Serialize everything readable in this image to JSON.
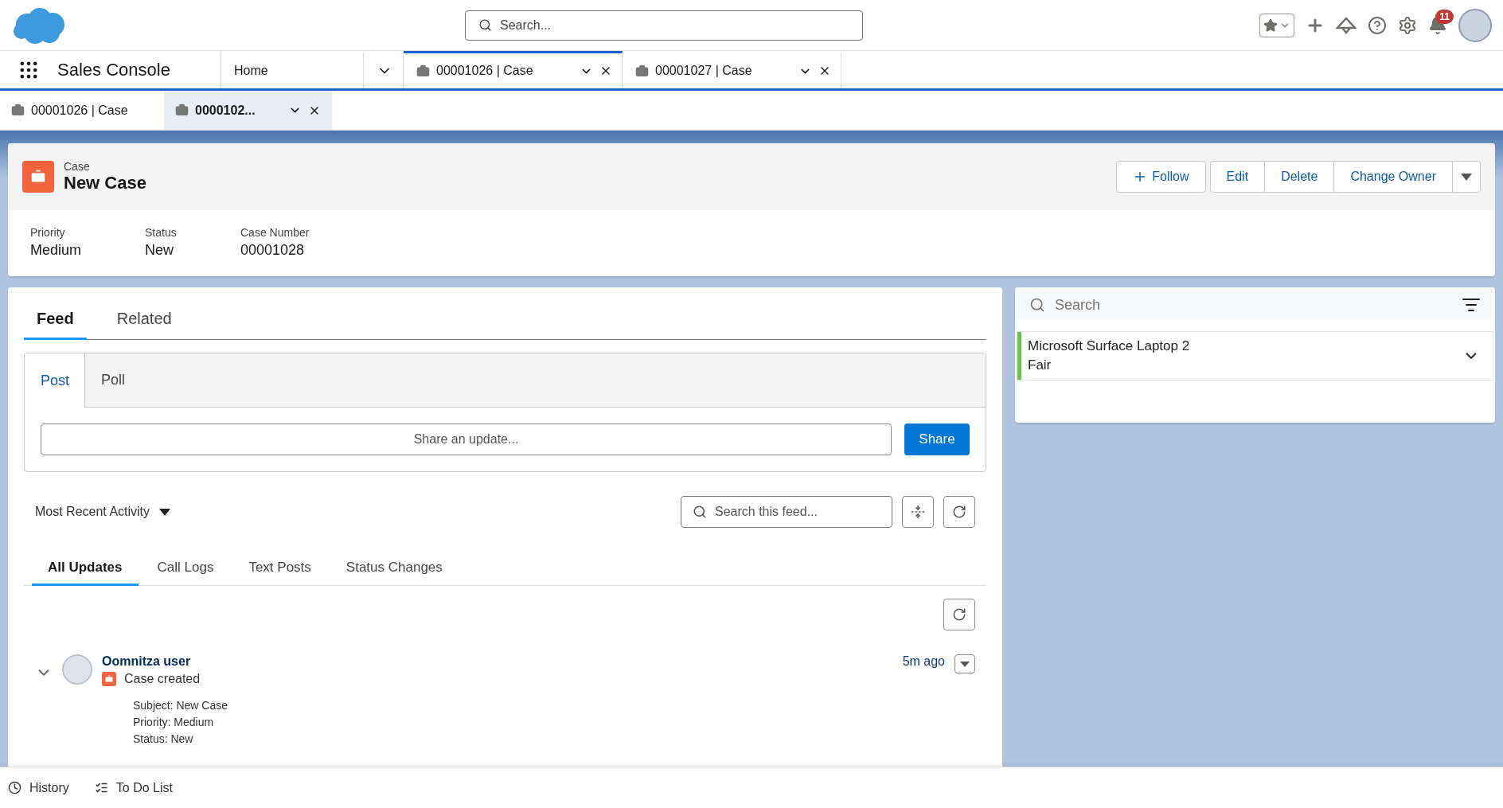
{
  "header": {
    "search": {
      "placeholder": "Search..."
    },
    "notifications": "11"
  },
  "nav": {
    "app_name": "Sales Console",
    "tabs": [
      {
        "label": "Home",
        "kind": "home",
        "selected": false
      },
      {
        "label": "00001026 | Case",
        "kind": "record",
        "selected": true
      },
      {
        "label": "00001027 | Case",
        "kind": "record",
        "selected": false
      }
    ]
  },
  "subtabs": [
    {
      "label": "00001026 | Case",
      "selected": false
    },
    {
      "label": "0000102...",
      "selected": true
    }
  ],
  "record": {
    "object": "Case",
    "title": "New Case",
    "actions": [
      "Follow",
      "Edit",
      "Delete",
      "Change Owner"
    ],
    "fields": [
      {
        "label": "Priority",
        "value": "Medium"
      },
      {
        "label": "Status",
        "value": "New"
      },
      {
        "label": "Case Number",
        "value": "00001028"
      }
    ]
  },
  "feed": {
    "tabs": [
      {
        "label": "Feed",
        "selected": true
      },
      {
        "label": "Related",
        "selected": false
      }
    ],
    "publisher_tabs": [
      {
        "label": "Post",
        "selected": true
      },
      {
        "label": "Poll",
        "selected": false
      }
    ],
    "update": {
      "placeholder": "Share an update..."
    },
    "share": "Share",
    "sort": "Most Recent Activity",
    "search": {
      "placeholder": "Search this feed..."
    },
    "filters": [
      {
        "label": "All Updates",
        "selected": true
      },
      {
        "label": "Call Logs",
        "selected": false
      },
      {
        "label": "Text Posts",
        "selected": false
      },
      {
        "label": "Status Changes",
        "selected": false
      }
    ],
    "items": [
      {
        "author": "Oomnitza user",
        "action": "Case created",
        "time": "5m ago",
        "expanded": true,
        "details": [
          "Subject: New Case",
          "Priority: Medium",
          "Status: New"
        ]
      }
    ]
  },
  "side": {
    "search": {
      "placeholder": "Search"
    },
    "assets": [
      {
        "name": "Microsoft Surface Laptop 2",
        "condition": "Fair",
        "color": "#6cc24a"
      }
    ]
  },
  "utility_bar": [
    {
      "label": "History",
      "kind": "history"
    },
    {
      "label": "To Do List",
      "kind": "todo"
    }
  ]
}
